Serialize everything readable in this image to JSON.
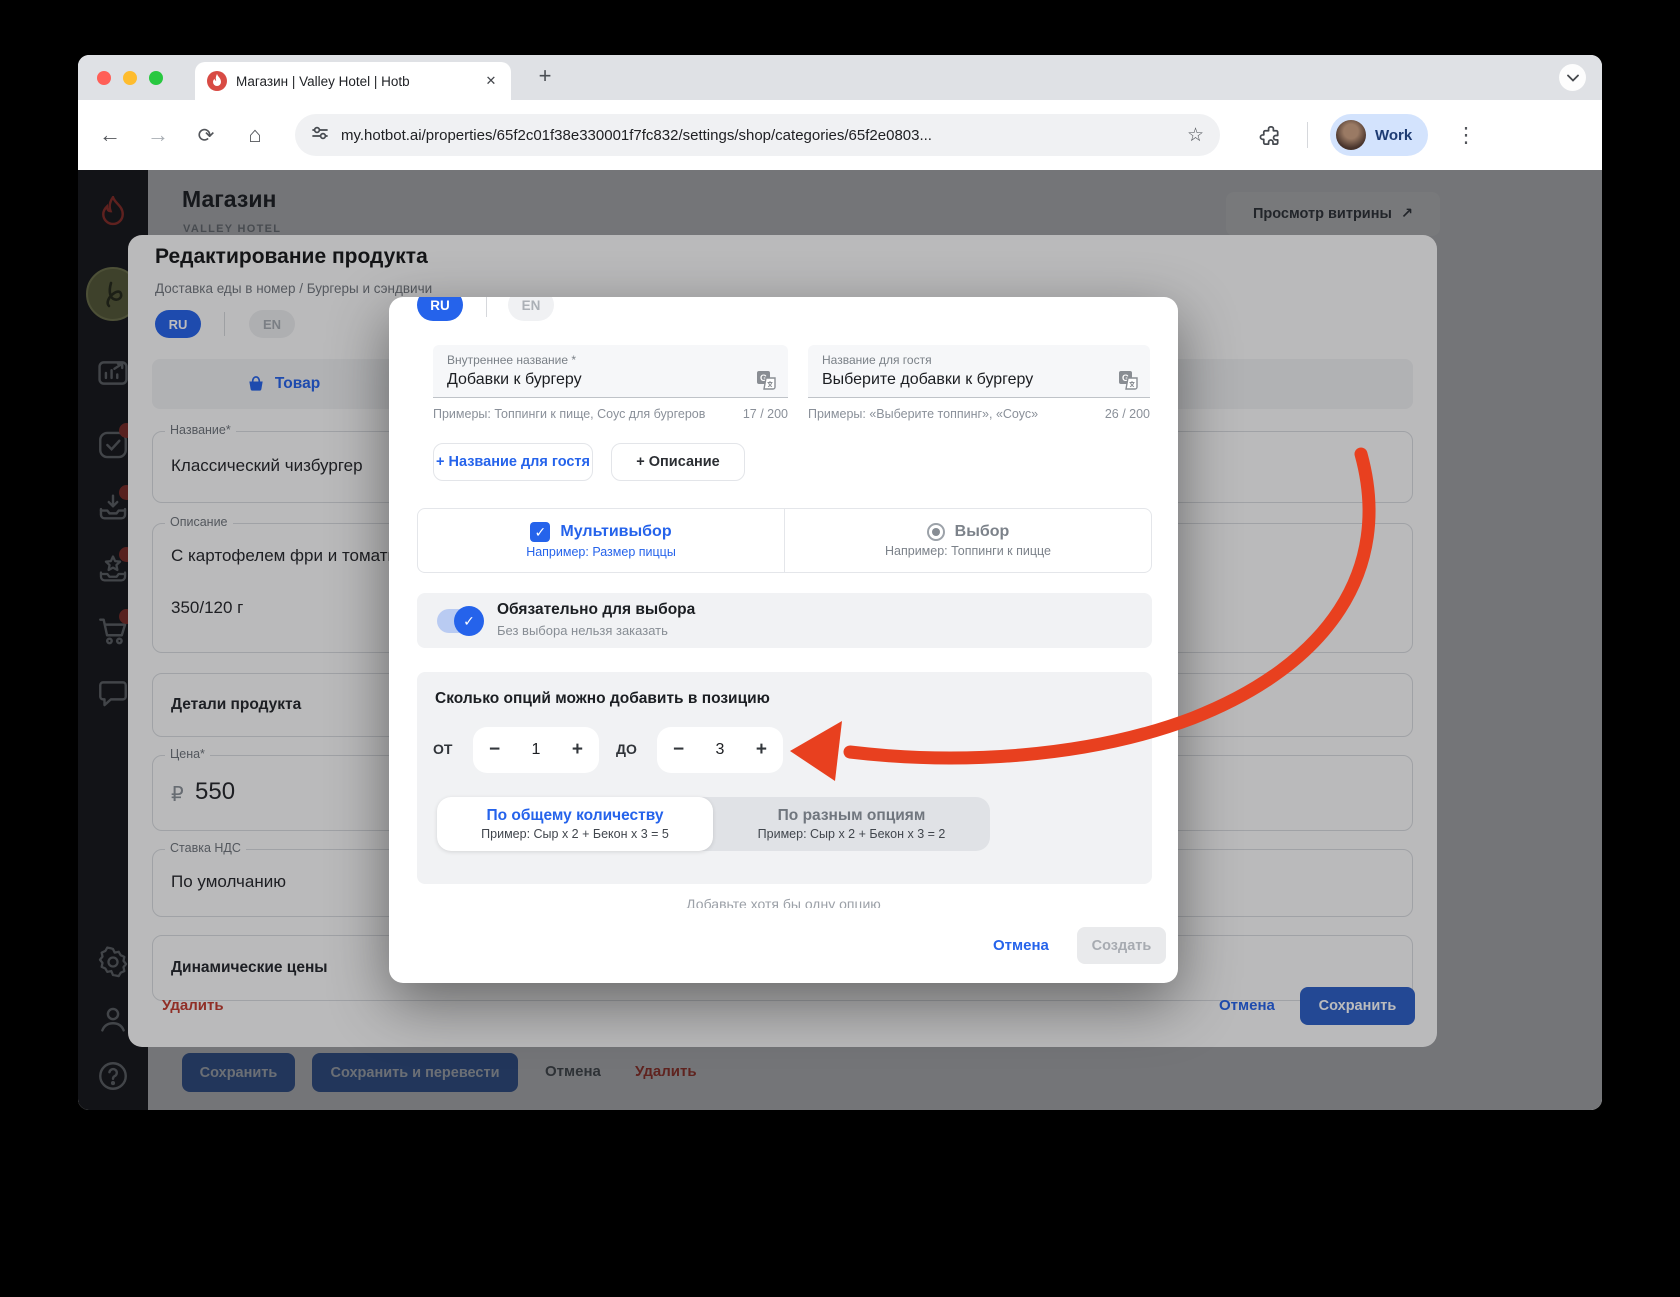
{
  "browser": {
    "tab_title": "Магазин | Valley Hotel | Hotb",
    "url": "my.hotbot.ai/properties/65f2c01f38e330001f7fc832/settings/shop/categories/65f2e0803...",
    "profile_label": "Work",
    "glyphs": {
      "close": "✕",
      "newtab": "+",
      "back": "←",
      "forward": "→",
      "reload": "⟳",
      "home": "⌂",
      "star": "☆",
      "kebab": "⋮"
    }
  },
  "page": {
    "title": "Магазин",
    "subtitle": "VALLEY HOTEL",
    "preview_button": "Просмотр витрины",
    "preview_arrow": "↗",
    "footer": {
      "save": "Сохранить",
      "save_translate": "Сохранить и перевести",
      "cancel": "Отмена",
      "delete": "Удалить"
    }
  },
  "edit_modal": {
    "title": "Редактирование продукта",
    "breadcrumb": "Доставка еды в номер / Бургеры и сэндвичи",
    "lang_ru": "RU",
    "lang_en": "EN",
    "tab_product": "Товар",
    "fields": {
      "name_label": "Название*",
      "name_value": "Классический чизбургер",
      "desc_label": "Описание",
      "desc_value_line1": "С картофелем фри и томатны",
      "desc_value_line2": "350/120 г",
      "details_label": "Детали продукта",
      "price_label": "Цена*",
      "price_currency": "₽",
      "price_value": "550",
      "vat_label": "Ставка НДС",
      "vat_value": "По умолчанию",
      "dynamic_label": "Динамические цены"
    },
    "footer": {
      "delete": "Удалить",
      "cancel": "Отмена",
      "save": "Сохранить"
    }
  },
  "option_modal": {
    "lang_ru": "RU",
    "lang_en": "EN",
    "internal_name": {
      "label": "Внутреннее название *",
      "value": "Добавки к бургеру",
      "hint": "Примеры: Топпинги к пище, Соус для бургеров",
      "counter": "17 / 200"
    },
    "guest_name": {
      "label": "Название для гостя",
      "value": "Выберите добавки к бургеру",
      "hint": "Примеры: «Выберите топпинг», «Соус»",
      "counter": "26 / 200"
    },
    "add_guest_name_btn": "+ Название для гостя",
    "add_description_btn": "+ Описание",
    "multi_choice": {
      "label": "Мультивыбор",
      "hint": "Например: Размер пиццы",
      "check": "✓"
    },
    "single_choice": {
      "label": "Выбор",
      "hint": "Например: Топпинги к пицце"
    },
    "required": {
      "label": "Обязательно для выбора",
      "hint": "Без выбора нельзя заказать",
      "check": "✓"
    },
    "options_count": {
      "title": "Сколько опций можно добавить в позицию",
      "from_label": "ОТ",
      "from_value": "1",
      "to_label": "ДО",
      "to_value": "3",
      "minus": "−",
      "plus": "+",
      "mode_total": {
        "label": "По общему количеству",
        "hint": "Пример: Сыр х 2 + Бекон х 3 = 5"
      },
      "mode_per_option": {
        "label": "По разным опциям",
        "hint": "Пример: Сыр х 2 + Бекон х 3 = 2"
      }
    },
    "empty_hint": "Добавьте хотя бы одну опцию",
    "footer": {
      "cancel": "Отмена",
      "create": "Создать"
    }
  },
  "colors": {
    "accent": "#2563EB",
    "danger": "#C23B2E",
    "arrow": "#E8401F"
  }
}
